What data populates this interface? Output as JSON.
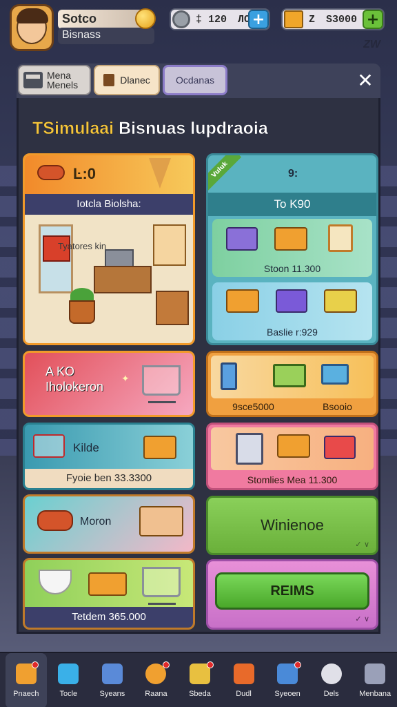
{
  "player": {
    "name": "Sotco",
    "subtitle": "Bisnass"
  },
  "resources": [
    {
      "icon": "gear-icon",
      "amount": "‡ 120",
      "extra": "ЛO",
      "action": "+"
    },
    {
      "icon": "crate-icon",
      "amount": "Z",
      "extra": "S3000",
      "action": "+"
    }
  ],
  "corner_text": "ZW",
  "tabs": [
    {
      "label": "Mena Menels",
      "icon": "store-icon"
    },
    {
      "label": "Dlanec",
      "icon": "door-icon"
    },
    {
      "label": "Ocdanas",
      "icon": ""
    }
  ],
  "close_label": "✕",
  "panel": {
    "title_highlight": "TSimulaai",
    "title_rest": "Bisnuas lupdraoia"
  },
  "cards": {
    "feature": {
      "price": "Ŀ:0",
      "subtitle": "Iotcla Biolsha:",
      "scene_caption": "Tyatores kin"
    },
    "teal": {
      "ribbon": "Vuluk",
      "hint": "9:",
      "title": "To K90",
      "rowA_caption": "Stoon 11.300",
      "rowB_caption": "Baslie r:929"
    },
    "pink": {
      "label_line1": "A KO",
      "label_line2": "Iholokeron"
    },
    "cyan": {
      "label": "Kilde",
      "footer": "Fyoie ben 33.3300"
    },
    "food": {
      "label": "Moron"
    },
    "green": {
      "footer": "Tetdem 365.000"
    },
    "orange": {
      "caption_left": "9sce5000",
      "caption_right": "Bsooio"
    },
    "pink2": {
      "caption": "Stomlies Mea 11.300"
    },
    "win": {
      "label": "Winienoe",
      "chev": "✓ ∨"
    },
    "reims": {
      "button": "REIMS",
      "chev": "✓ ∨"
    }
  },
  "bottom_nav": [
    {
      "label": "Pnaech",
      "icon": "home-icon",
      "badge": true,
      "active": true
    },
    {
      "label": "Tocle",
      "icon": "diamond-icon",
      "badge": false,
      "active": false
    },
    {
      "label": "Syeans",
      "icon": "book-icon",
      "badge": false,
      "active": false
    },
    {
      "label": "Raana",
      "icon": "coin-icon",
      "badge": true,
      "active": false
    },
    {
      "label": "Sbeda",
      "icon": "gift-icon",
      "badge": true,
      "active": false
    },
    {
      "label": "Dudl",
      "icon": "chat-icon",
      "badge": false,
      "active": false
    },
    {
      "label": "Syeoen",
      "icon": "calendar-icon",
      "badge": true,
      "active": false
    },
    {
      "label": "Dels",
      "icon": "globe-icon",
      "badge": false,
      "active": false
    },
    {
      "label": "Menbana",
      "icon": "profile-icon",
      "badge": false,
      "active": false
    }
  ],
  "colors": {
    "accent_orange": "#f19a2a",
    "accent_green": "#6bc13a",
    "title_highlight": "#f5c53a",
    "panel_bg": "#2e3142"
  }
}
